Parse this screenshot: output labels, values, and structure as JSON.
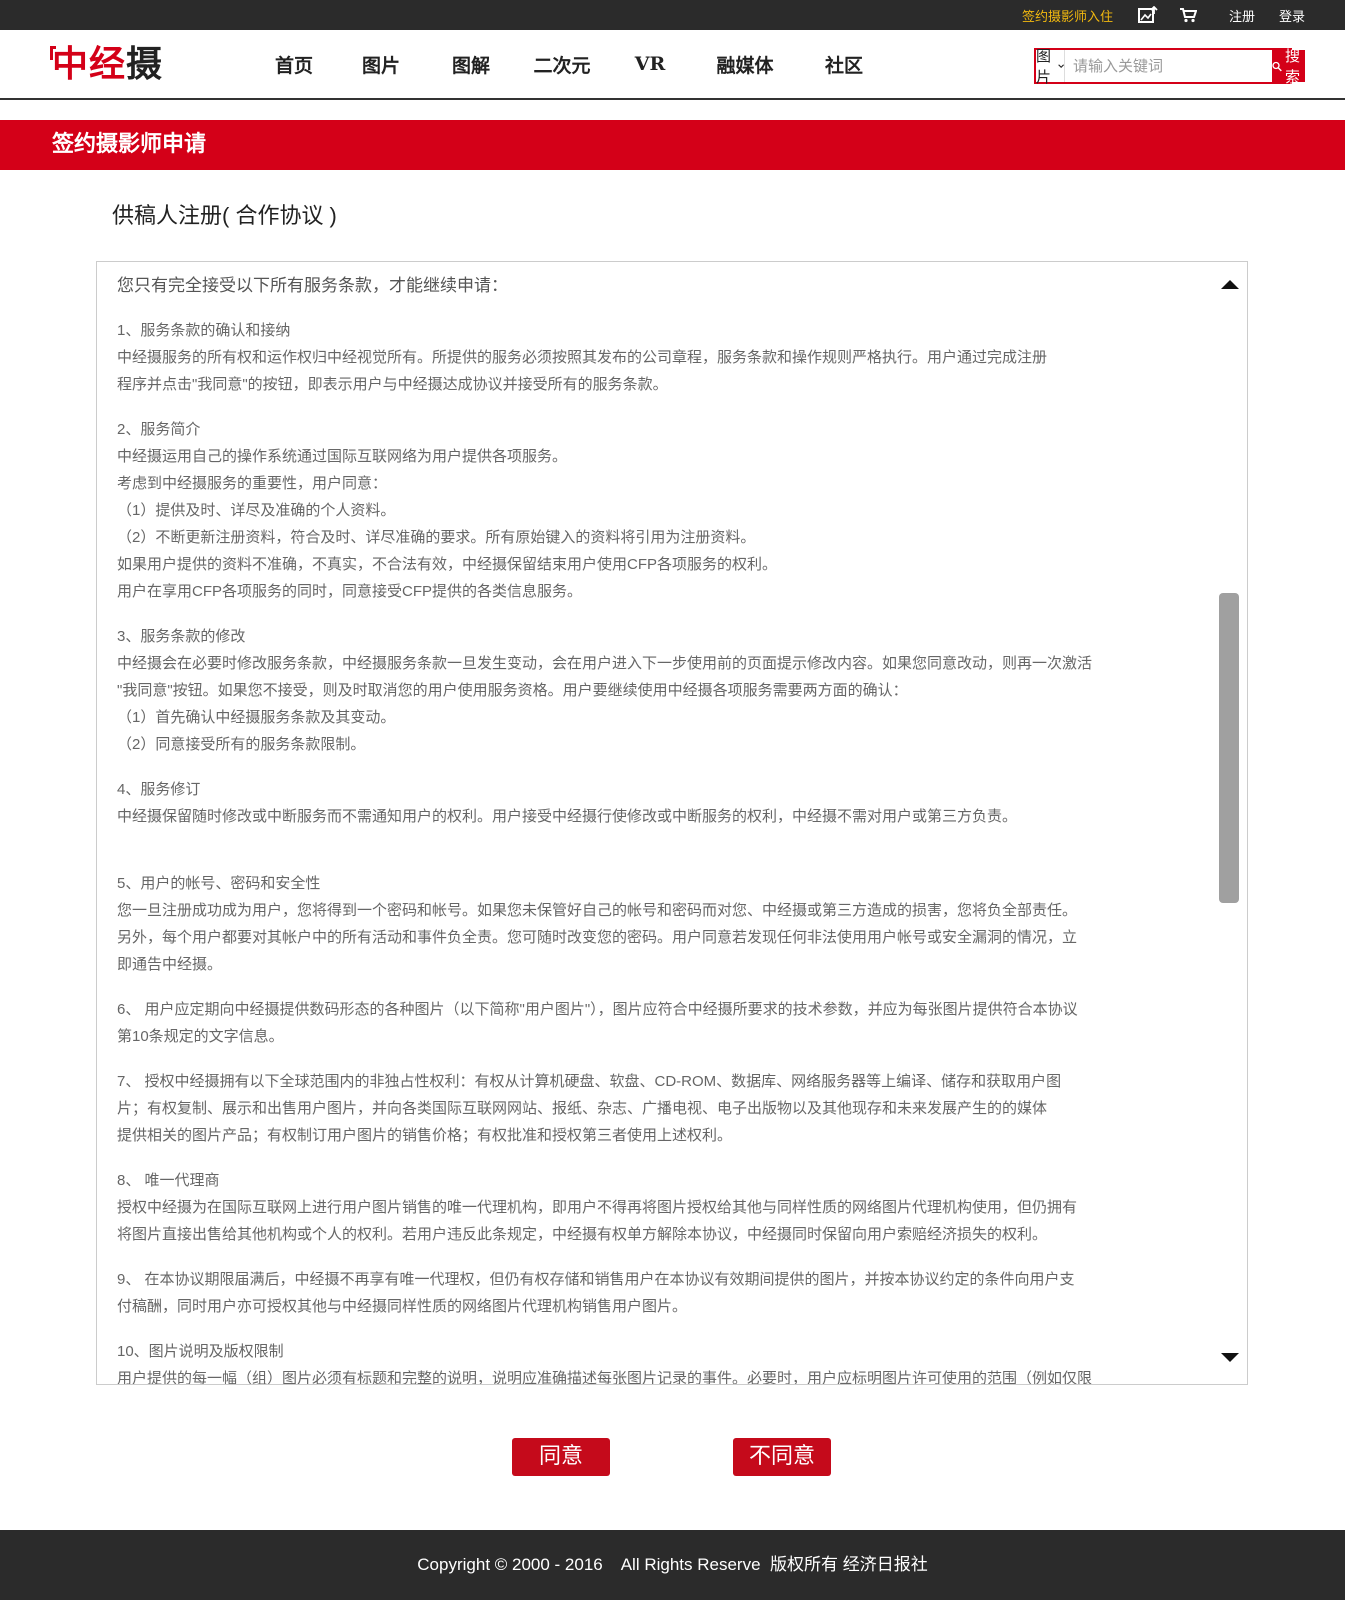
{
  "topbar": {
    "signed_link": "签约摄影师入住",
    "register": "注册",
    "login": "登录"
  },
  "header": {
    "logo_red": "中经",
    "logo_dark": "摄",
    "nav": [
      "首页",
      "图片",
      "图解",
      "二次元",
      "VR",
      "融媒体",
      "社区"
    ],
    "search": {
      "category": "图片",
      "placeholder": "请输入关键词",
      "button": "搜索"
    }
  },
  "banner": {
    "title": "签约摄影师申请"
  },
  "page": {
    "subtitle": "供稿人注册( 合作协议 )"
  },
  "terms": {
    "lead": "您只有完全接受以下所有服务条款，才能继续申请：",
    "sections": [
      {
        "lines": [
          "1、服务条款的确认和接纳",
          "中经摄服务的所有权和运作权归中经视觉所有。所提供的服务必须按照其发布的公司章程，服务条款和操作规则严格执行。用户通过完成注册",
          "程序并点击\"我同意\"的按钮，即表示用户与中经摄达成协议并接受所有的服务条款。"
        ]
      },
      {
        "lines": [
          "2、服务简介",
          "中经摄运用自己的操作系统通过国际互联网络为用户提供各项服务。",
          "考虑到中经摄服务的重要性，用户同意：",
          "（1）提供及时、详尽及准确的个人资料。",
          "（2）不断更新注册资料，符合及时、详尽准确的要求。所有原始键入的资料将引用为注册资料。",
          "如果用户提供的资料不准确，不真实，不合法有效，中经摄保留结束用户使用CFP各项服务的权利。",
          "用户在享用CFP各项服务的同时，同意接受CFP提供的各类信息服务。"
        ]
      },
      {
        "lines": [
          "3、服务条款的修改",
          "中经摄会在必要时修改服务条款，中经摄服务条款一旦发生变动，会在用户进入下一步使用前的页面提示修改内容。如果您同意改动，则再一次激活",
          "\"我同意\"按钮。如果您不接受，则及时取消您的用户使用服务资格。用户要继续使用中经摄各项服务需要两方面的确认：",
          "（1）首先确认中经摄服务条款及其变动。",
          "（2）同意接受所有的服务条款限制。"
        ]
      },
      {
        "lines": [
          "4、服务修订",
          "中经摄保留随时修改或中断服务而不需通知用户的权利。用户接受中经摄行使修改或中断服务的权利，中经摄不需对用户或第三方负责。"
        ]
      },
      {
        "lines": [
          "5、用户的帐号、密码和安全性",
          "您一旦注册成功成为用户，您将得到一个密码和帐号。如果您未保管好自己的帐号和密码而对您、中经摄或第三方造成的损害，您将负全部责任。",
          "另外，每个用户都要对其帐户中的所有活动和事件负全责。您可随时改变您的密码。用户同意若发现任何非法使用用户帐号或安全漏洞的情况，立",
          "即通告中经摄。"
        ]
      },
      {
        "lines": [
          "6、 用户应定期向中经摄提供数码形态的各种图片（以下简称\"用户图片\"），图片应符合中经摄所要求的技术参数，并应为每张图片提供符合本协议",
          "第10条规定的文字信息。"
        ]
      },
      {
        "lines": [
          "7、 授权中经摄拥有以下全球范围内的非独占性权利：有权从计算机硬盘、软盘、CD-ROM、数据库、网络服务器等上编译、储存和获取用户图",
          "片；有权复制、展示和出售用户图片，并向各类国际互联网网站、报纸、杂志、广播电视、电子出版物以及其他现存和未来发展产生的的媒体",
          "提供相关的图片产品；有权制订用户图片的销售价格；有权批准和授权第三者使用上述权利。"
        ]
      },
      {
        "lines": [
          "8、 唯一代理商",
          "授权中经摄为在国际互联网上进行用户图片销售的唯一代理机构，即用户不得再将图片授权给其他与同样性质的网络图片代理机构使用，但仍拥有",
          "将图片直接出售给其他机构或个人的权利。若用户违反此条规定，中经摄有权单方解除本协议，中经摄同时保留向用户索赔经济损失的权利。"
        ]
      },
      {
        "lines": [
          "9、 在本协议期限届满后，中经摄不再享有唯一代理权，但仍有权存储和销售用户在本协议有效期间提供的图片，并按本协议约定的条件向用户支",
          "付稿酬，同时用户亦可授权其他与中经摄同样性质的网络图片代理机构销售用户图片。"
        ]
      },
      {
        "lines": [
          "10、图片说明及版权限制",
          "用户提供的每一幅（组）图片必须有标题和完整的说明，说明应准确描述每张图片记录的事件。必要时，用户应标明图片许可使用的范围（例如仅限"
        ]
      }
    ]
  },
  "actions": {
    "agree": "同意",
    "disagree": "不同意"
  },
  "footer": {
    "copyright": "Copyright © 2000 - 2016    All Rights Reserve  版权所有 经济日报社"
  }
}
